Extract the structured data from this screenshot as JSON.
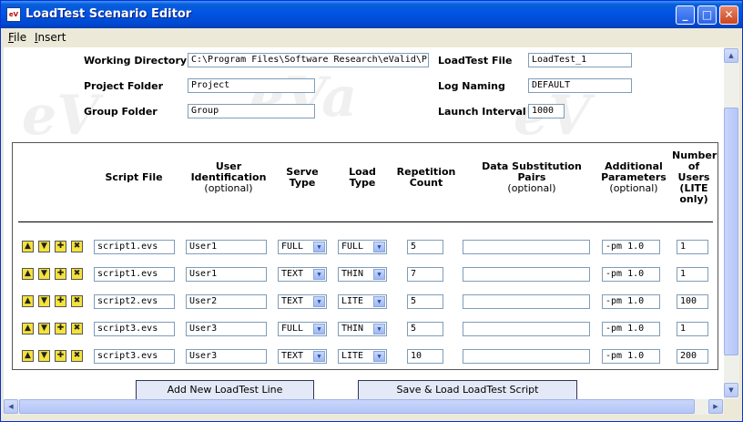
{
  "window": {
    "title": "LoadTest Scenario Editor",
    "icon_text": "eV"
  },
  "menu": [
    {
      "label_u": "F",
      "label_rest": "ile"
    },
    {
      "label_u": "I",
      "label_rest": "nsert"
    }
  ],
  "settings": {
    "working_directory_label": "Working Directory",
    "working_directory_value": "C:\\Program Files\\Software Research\\eValid\\Pro",
    "project_folder_label": "Project Folder",
    "project_folder_value": "Project",
    "group_folder_label": "Group Folder",
    "group_folder_value": "Group",
    "loadtest_file_label": "LoadTest File",
    "loadtest_file_value": "LoadTest_1",
    "log_naming_label": "Log Naming",
    "log_naming_value": "DEFAULT",
    "launch_interval_label": "Launch Interval",
    "launch_interval_value": "1000"
  },
  "columns": {
    "script_file": "Script File",
    "user_id": "User Identification",
    "user_id_opt": "(optional)",
    "serve_type": "Serve Type",
    "load_type": "Load Type",
    "rep_count": "Repetition Count",
    "data_sub": "Data Substitution Pairs",
    "data_sub_opt": "(optional)",
    "add_params": "Additional Parameters",
    "add_params_opt": "(optional)",
    "num_users": "Number of Users (LITE only)"
  },
  "rows": [
    {
      "script": "script1.evs",
      "user": "User1",
      "serve": "FULL",
      "load": "FULL",
      "reps": "5",
      "data": "",
      "params": "-pm 1.0",
      "users": "1"
    },
    {
      "script": "script1.evs",
      "user": "User1",
      "serve": "TEXT",
      "load": "THIN",
      "reps": "7",
      "data": "",
      "params": "-pm 1.0",
      "users": "1"
    },
    {
      "script": "script2.evs",
      "user": "User2",
      "serve": "TEXT",
      "load": "LITE",
      "reps": "5",
      "data": "",
      "params": "-pm 1.0",
      "users": "100"
    },
    {
      "script": "script3.evs",
      "user": "User3",
      "serve": "FULL",
      "load": "THIN",
      "reps": "5",
      "data": "",
      "params": "-pm 1.0",
      "users": "1"
    },
    {
      "script": "script3.evs",
      "user": "User3",
      "serve": "TEXT",
      "load": "LITE",
      "reps": "10",
      "data": "",
      "params": "-pm 1.0",
      "users": "200"
    }
  ],
  "row_icons": [
    "move-up-icon",
    "move-down-icon",
    "add-line-icon",
    "delete-line-icon"
  ],
  "buttons": {
    "add_line": "Add New LoadTest Line",
    "save_load": "Save & Load LoadTest Script"
  },
  "watermark": "eValid"
}
